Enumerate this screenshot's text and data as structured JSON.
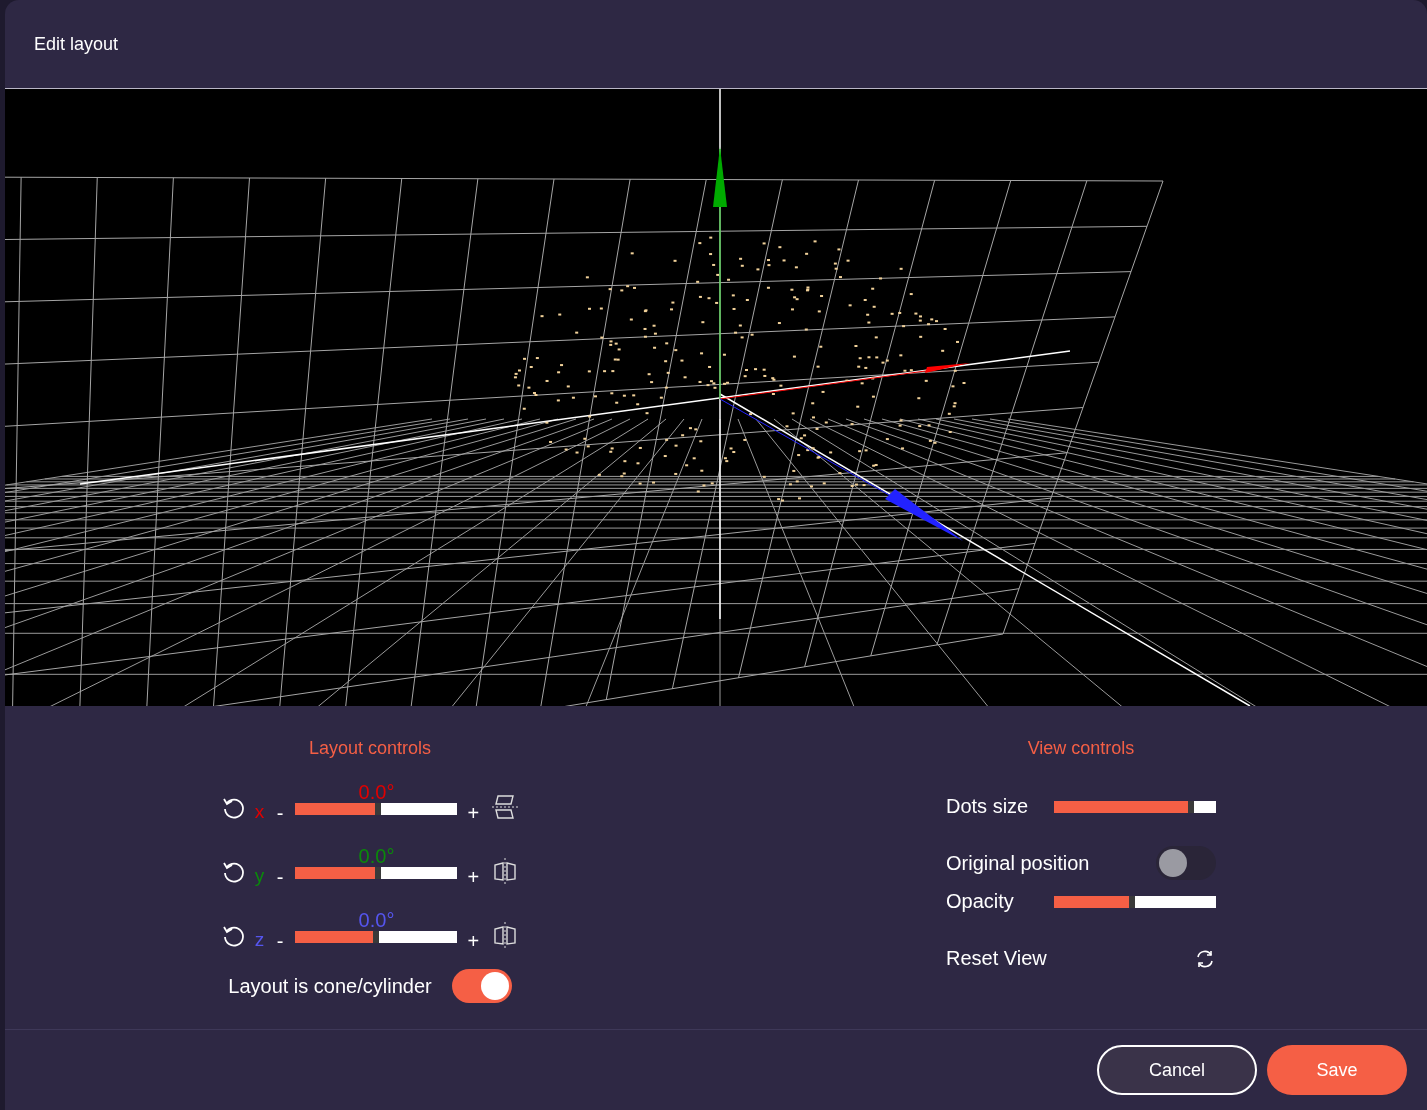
{
  "dialog": {
    "title": "Edit layout"
  },
  "layout_controls": {
    "title": "Layout controls",
    "axes": [
      {
        "letter": "x",
        "angle": "0.0°",
        "color": "#e00000",
        "level": 0.49,
        "minus": "-",
        "plus": "+"
      },
      {
        "letter": "y",
        "angle": "0.0°",
        "color": "#0a8a0a",
        "level": 0.49,
        "minus": "-",
        "plus": "+"
      },
      {
        "letter": "z",
        "angle": "0.0°",
        "color": "#5555ee",
        "level": 0.48,
        "minus": "-",
        "plus": "+"
      }
    ],
    "cone_toggle": {
      "label": "Layout is cone/cylinder",
      "on": true
    }
  },
  "view_controls": {
    "title": "View controls",
    "dots_size": {
      "label": "Dots size",
      "level": 0.83
    },
    "original_position": {
      "label": "Original position",
      "on": false
    },
    "opacity": {
      "label": "Opacity",
      "level": 0.46
    },
    "reset": {
      "label": "Reset View"
    }
  },
  "buttons": {
    "cancel": "Cancel",
    "save": "Save"
  }
}
